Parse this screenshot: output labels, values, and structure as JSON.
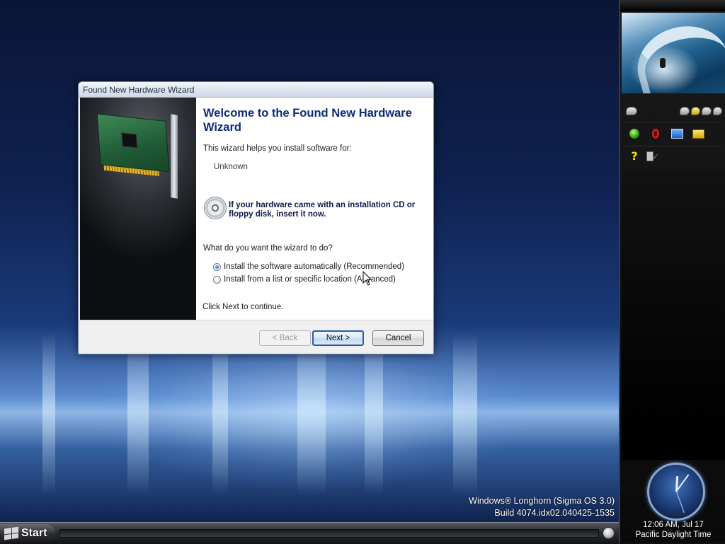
{
  "desktop": {
    "watermark_line1": "Windows® Longhorn (Sigma OS 3.0)",
    "watermark_line2": "Build 4074.idx02.040425-1535"
  },
  "taskbar": {
    "start_label": "Start"
  },
  "sidebar": {
    "clock_time": "12:06 AM, Jul 17",
    "clock_timezone": "Pacific Daylight Time",
    "tray_icons_row1": [
      "chat-bubbles-icon",
      "chat-bubbles-group-icon"
    ],
    "tray_icons_row2": [
      "green-orb-icon",
      "opera-icon",
      "monitor-icon",
      "folder-pencil-icon"
    ],
    "tray_icons_row3": [
      "help-icon",
      "safely-remove-hardware-icon"
    ]
  },
  "wizard": {
    "title": "Found New Hardware Wizard",
    "heading": "Welcome to the Found New Hardware Wizard",
    "intro": "This wizard helps you install software for:",
    "device": "Unknown",
    "cd_prompt": "If your hardware came with an installation CD or floppy disk, insert it now.",
    "question": "What do you want the wizard to do?",
    "options": [
      {
        "label": "Install the software automatically (Recommended)",
        "checked": true
      },
      {
        "label": "Install from a list or specific location (Advanced)",
        "checked": false
      }
    ],
    "continue_text": "Click Next to continue.",
    "buttons": {
      "back": "< Back",
      "next": "Next >",
      "cancel": "Cancel"
    }
  }
}
